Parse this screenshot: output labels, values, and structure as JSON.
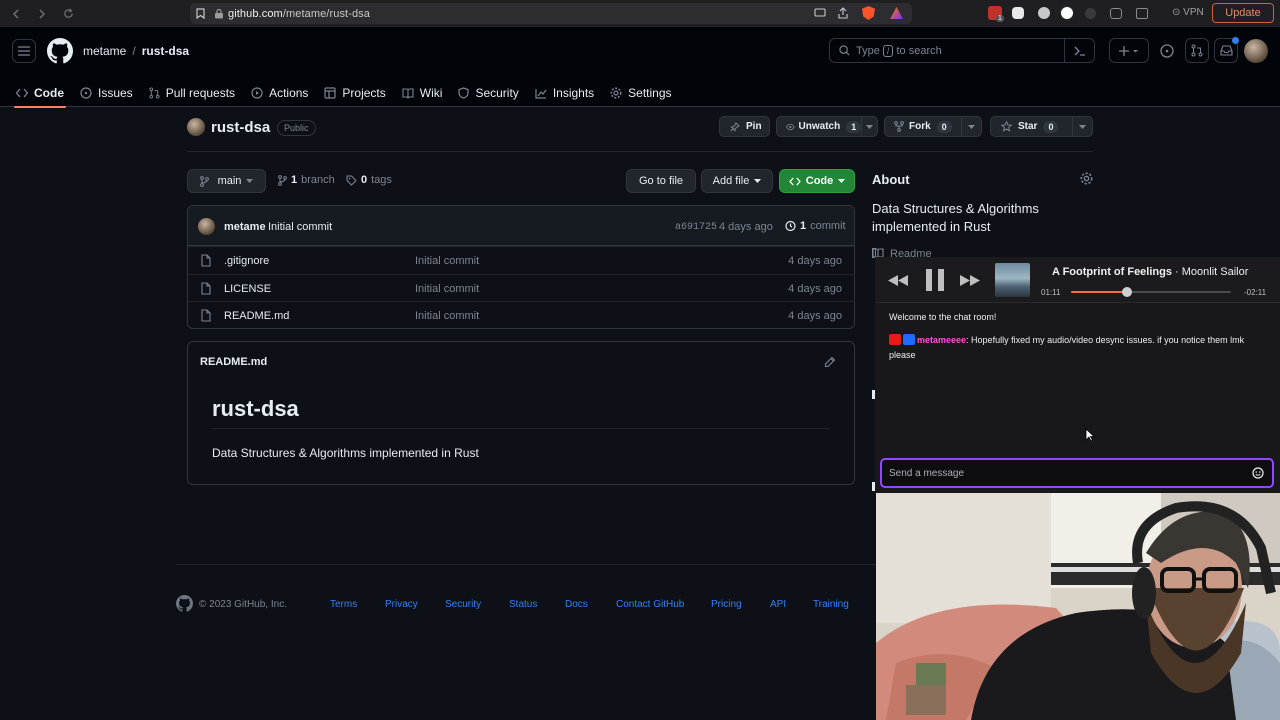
{
  "browser": {
    "url_host": "github.com",
    "url_path": "/metame/rust-dsa",
    "vpn_label": "VPN",
    "update_label": "Update",
    "ext_badge": "1"
  },
  "header": {
    "owner": "metame",
    "separator": "/",
    "repo": "rust-dsa",
    "search_placeholder": "Type [/] to search",
    "search_pre": "Type",
    "search_key": "/",
    "search_post": "to search"
  },
  "tabs": [
    {
      "label": "Code",
      "icon": "code-icon"
    },
    {
      "label": "Issues",
      "icon": "issue-icon"
    },
    {
      "label": "Pull requests",
      "icon": "pull-request-icon"
    },
    {
      "label": "Actions",
      "icon": "play-icon"
    },
    {
      "label": "Projects",
      "icon": "table-icon"
    },
    {
      "label": "Wiki",
      "icon": "book-icon"
    },
    {
      "label": "Security",
      "icon": "shield-icon"
    },
    {
      "label": "Insights",
      "icon": "graph-icon"
    },
    {
      "label": "Settings",
      "icon": "gear-icon"
    }
  ],
  "repo": {
    "name": "rust-dsa",
    "visibility": "Public",
    "pin": "Pin",
    "unwatch": "Unwatch",
    "watch_count": "1",
    "fork": "Fork",
    "fork_count": "0",
    "star": "Star",
    "star_count": "0"
  },
  "toolbar": {
    "branch": "main",
    "branches_count": "1",
    "branches_label": "branch",
    "tags_count": "0",
    "tags_label": "tags",
    "go_to_file": "Go to file",
    "add_file": "Add file",
    "code": "Code"
  },
  "commit": {
    "user": "metame",
    "message": "Initial commit",
    "hash": "a691725",
    "date": "4 days ago",
    "count": "1",
    "count_label": "commit"
  },
  "files": [
    {
      "name": ".gitignore",
      "message": "Initial commit",
      "date": "4 days ago"
    },
    {
      "name": "LICENSE",
      "message": "Initial commit",
      "date": "4 days ago"
    },
    {
      "name": "README.md",
      "message": "Initial commit",
      "date": "4 days ago"
    }
  ],
  "readme": {
    "filename": "README.md",
    "title": "rust-dsa",
    "description": "Data Structures & Algorithms implemented in Rust"
  },
  "about": {
    "heading": "About",
    "description": "Data Structures & Algorithms implemented in Rust",
    "readme_link": "Readme"
  },
  "footer": {
    "copyright": "© 2023 GitHub, Inc.",
    "links": [
      "Terms",
      "Privacy",
      "Security",
      "Status",
      "Docs",
      "Contact GitHub",
      "Pricing",
      "API",
      "Training"
    ]
  },
  "player": {
    "track": "A Footprint of Feelings",
    "separator": "·",
    "artist": "Moonlit Sailor",
    "elapsed": "01:11",
    "remaining": "-02:11",
    "progress_fraction": 0.35
  },
  "chat": {
    "welcome": "Welcome to the chat room!",
    "messages": [
      {
        "user": "metameeee",
        "text": ": Hopefully fixed my audio/video desync issues. if you notice them lmk please"
      }
    ],
    "input_placeholder": "Send a message"
  },
  "colors": {
    "accent_tab": "#f78166",
    "link": "#2f81f7",
    "code_button": "#238636",
    "chat_border": "#9147ff",
    "chat_user": "#ff4fd8",
    "progress": "#ff6a3d"
  }
}
